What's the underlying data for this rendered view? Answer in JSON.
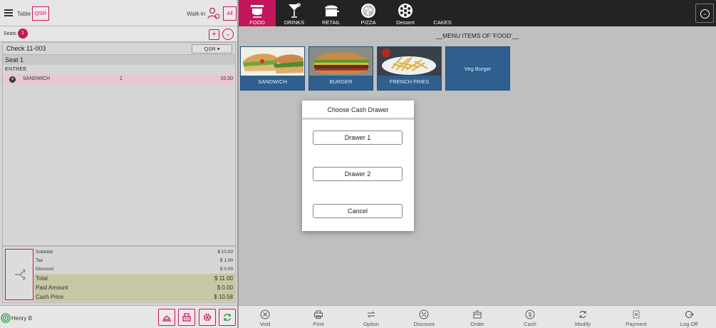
{
  "header": {
    "table_label": "Table",
    "qsr_label": "QSR",
    "walkin_label": "Walk-in",
    "all_label": "All"
  },
  "seats": {
    "label": "Seats",
    "count": "1",
    "plus": "+",
    "chevron": "⌄"
  },
  "order": {
    "check_label": "Check 11-003",
    "order_type": "QSR ▾",
    "seat_label": "Seat 1",
    "course_label": "ENTREE",
    "items": [
      {
        "name": "SANDWICH",
        "qty": "1",
        "price": "10.00"
      }
    ]
  },
  "totals": {
    "subtotal_label": "Subtotal",
    "subtotal": "$ 10.00",
    "tax_label": "Tax",
    "tax": "$ 1.00",
    "discount_label": "Discount",
    "discount": "$ 0.00",
    "total_label": "Total",
    "total": "$ 11.00",
    "paid_label": "Paid Amount",
    "paid": "$ 0.00",
    "cash_label": "Cash Price",
    "cash": "$ 10.58"
  },
  "user": {
    "name": "Henry B"
  },
  "categories": [
    {
      "label": "FOOD",
      "icon": "food-pot-icon",
      "active": true
    },
    {
      "label": "DRINKS",
      "icon": "cocktail-icon",
      "active": false
    },
    {
      "label": "RETAIL",
      "icon": "retail-icon",
      "active": false
    },
    {
      "label": "PIZZA",
      "icon": "pizza-icon",
      "active": false
    },
    {
      "label": "Dessert",
      "icon": "dessert-icon",
      "active": false
    },
    {
      "label": "CAKES",
      "icon": "",
      "active": false
    }
  ],
  "menu": {
    "title": "__MENU ITEMS OF 'FOOD'__",
    "items": [
      {
        "label": "SANDWICH"
      },
      {
        "label": "BURGER"
      },
      {
        "label": "FRENCH FRIES"
      },
      {
        "label": "Veg Burger"
      }
    ]
  },
  "toolbar": [
    {
      "label": "Void",
      "icon": "void-icon"
    },
    {
      "label": "Print",
      "icon": "printer-icon"
    },
    {
      "label": "Option",
      "icon": "option-icon"
    },
    {
      "label": "Discount",
      "icon": "discount-icon"
    },
    {
      "label": "Order",
      "icon": "order-icon"
    },
    {
      "label": "Cash",
      "icon": "cash-icon"
    },
    {
      "label": "Modify",
      "icon": "modify-icon"
    },
    {
      "label": "Payment",
      "icon": "payment-icon"
    },
    {
      "label": "Log Off",
      "icon": "logoff-icon"
    }
  ],
  "modal": {
    "title": "Choose Cash Drawer",
    "drawer1": "Drawer 1",
    "drawer2": "Drawer 2",
    "cancel": "Cancel"
  },
  "colors": {
    "accent": "#c2185b",
    "tile": "#2e5f8f",
    "topbar": "#232323"
  }
}
